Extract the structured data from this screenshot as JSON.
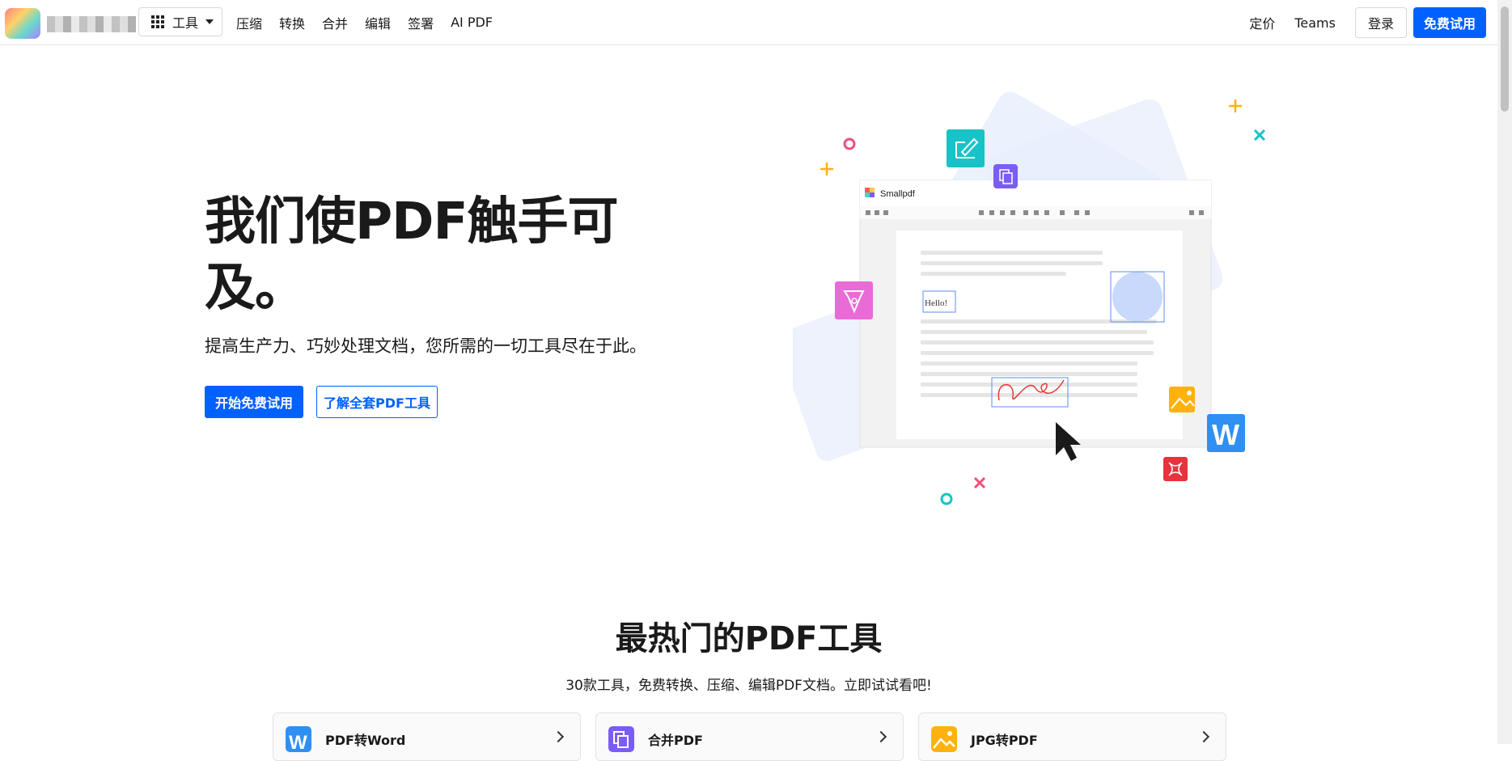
{
  "header": {
    "tools_label": "工具",
    "nav": [
      "压缩",
      "转换",
      "合并",
      "编辑",
      "签署",
      "AI PDF"
    ],
    "pricing": "定价",
    "teams": "Teams",
    "login": "登录",
    "free_trial": "免费试用"
  },
  "hero": {
    "title": "我们使PDF触手可及。",
    "subtitle": "提高生产力、巧妙处理文档，您所需的一切工具尽在于此。",
    "start_button": "开始免费试用",
    "learn_button": "了解全套PDF工具"
  },
  "illustration": {
    "app_name": "Smallpdf",
    "hello_text": "Hello!",
    "word_letter": "W"
  },
  "popular": {
    "title": "最热门的PDF工具",
    "subtitle": "30款工具，免费转换、压缩、编辑PDF文档。立即试试看吧!",
    "cards": [
      {
        "label": "PDF转Word",
        "icon": "word-icon",
        "color": "#2f8ff2"
      },
      {
        "label": "合并PDF",
        "icon": "merge-icon",
        "color": "#7b5cf5"
      },
      {
        "label": "JPG转PDF",
        "icon": "image-icon",
        "color": "#ffb20f"
      }
    ]
  },
  "colors": {
    "accent": "#0061fe"
  }
}
